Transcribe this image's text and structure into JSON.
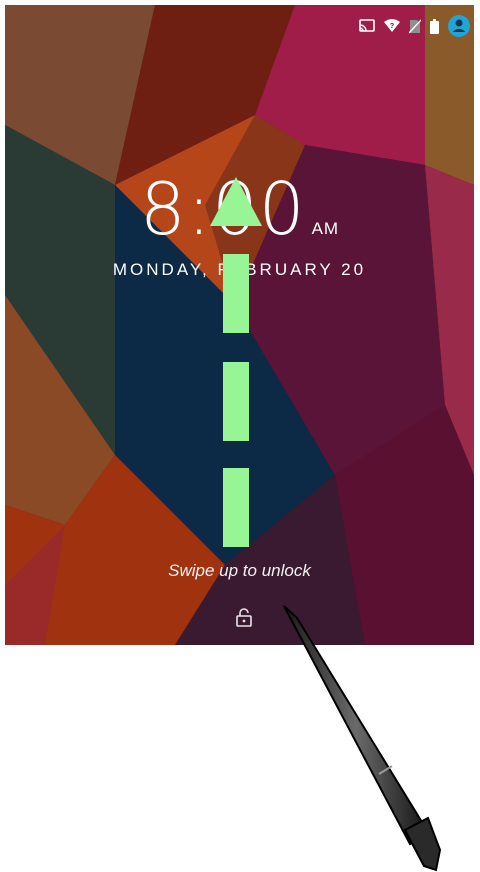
{
  "lockscreen": {
    "time": "8:00",
    "ampm": "AM",
    "date": "MONDAY, FEBRUARY 20",
    "hint": "Swipe up to unlock"
  },
  "statusbar": {
    "icons": [
      "cast-icon",
      "wifi-icon",
      "no-sim-icon",
      "battery-icon",
      "user-avatar-icon"
    ],
    "accent": "#1fa6d6"
  },
  "gesture": {
    "direction": "up",
    "arrow_color": "#98f595"
  },
  "colors": {
    "wallpaper_dark_blue": "#0e2a45",
    "wallpaper_red": "#8a1f14",
    "wallpaper_magenta": "#7a1a3c"
  }
}
